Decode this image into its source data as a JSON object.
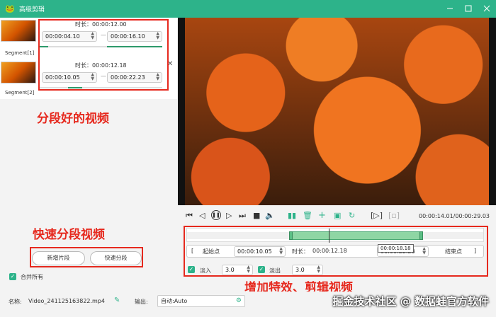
{
  "window": {
    "title": "高级剪辑"
  },
  "segments": [
    {
      "label": "Segment[1]",
      "duration": "时长：00:00:12.00",
      "start": "00:00:04.10",
      "end": "00:00:16.10"
    },
    {
      "label": "Segment[2]",
      "duration": "时长：00:00:12.18",
      "start": "00:00:10.05",
      "end": "00:00:22.23"
    }
  ],
  "annotations": {
    "segments": "分段好的视频",
    "quick": "快速分段视频",
    "effects": "增加特效、剪辑视频"
  },
  "buttons": {
    "add_segment": "新增片段",
    "quick_segment": "快速分段",
    "merge_all": "合并所有"
  },
  "player": {
    "time_display": "00:00:14.01/00:00:29.03"
  },
  "editor": {
    "start_label": "起始点",
    "start_value": "00:00:10.05",
    "duration_label": "时长：",
    "duration_value": "00:00:12.18",
    "end_value": "00:00:22.23",
    "end_label": "结束点",
    "tooltip": "00:00:18.18",
    "fade_in_label": "淡入",
    "fade_in_value": "3.0",
    "fade_out_label": "淡出",
    "fade_out_value": "3.0"
  },
  "output": {
    "name_label": "名称:",
    "name_value": "Video_241125163822.mp4",
    "output_label": "输出:",
    "output_value": "自动:Auto"
  },
  "watermark": "掘金技术社区 @ 数据蛙官方软件",
  "colors": {
    "accent": "#2db38a",
    "annotation": "#e6291e"
  }
}
